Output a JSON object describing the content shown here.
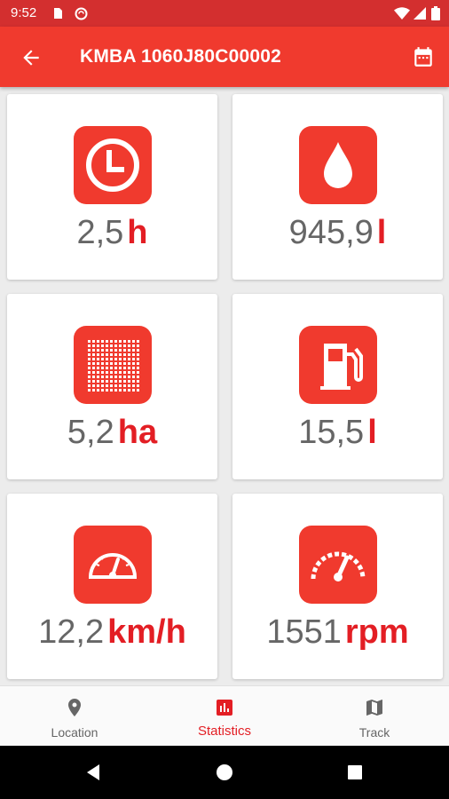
{
  "status_bar": {
    "time": "9:52"
  },
  "app_bar": {
    "title": "KMBA 1060J80C00002"
  },
  "stats": [
    {
      "icon": "clock-icon",
      "value": "2,5",
      "unit": "h"
    },
    {
      "icon": "water-drop-icon",
      "value": "945,9",
      "unit": "l"
    },
    {
      "icon": "area-grid-icon",
      "value": "5,2",
      "unit": "ha"
    },
    {
      "icon": "fuel-pump-icon",
      "value": "15,5",
      "unit": "l"
    },
    {
      "icon": "speedometer-icon",
      "value": "12,2",
      "unit": "km/h"
    },
    {
      "icon": "tachometer-icon",
      "value": "1551",
      "unit": "rpm"
    }
  ],
  "bottom_nav": [
    {
      "label": "Location",
      "icon": "location-pin-icon",
      "active": false
    },
    {
      "label": "Statistics",
      "icon": "bar-chart-icon",
      "active": true
    },
    {
      "label": "Track",
      "icon": "map-icon",
      "active": false
    }
  ],
  "colors": {
    "primary": "#f03a2e",
    "status_bar": "#d32f2f",
    "accent_text": "#e31e24"
  }
}
